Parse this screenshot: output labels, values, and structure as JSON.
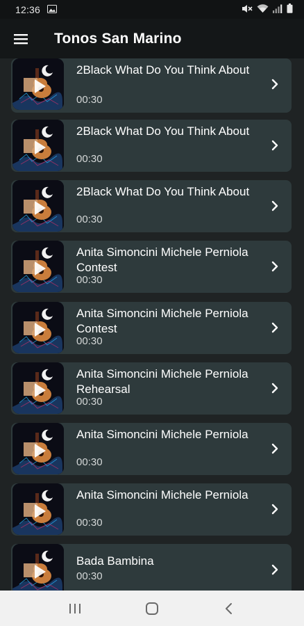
{
  "status": {
    "time": "12:36"
  },
  "app": {
    "title": "Tonos San Marino"
  },
  "icons": {
    "menu": "menu-icon",
    "chevron": "chevron-right-icon",
    "thumbnail": "guitar-play-icon"
  },
  "colors": {
    "background": "#1f2324",
    "card": "#2e3a3c",
    "app_bar": "#141718",
    "text": "#ffffff",
    "nav_bar": "#f1f1f1"
  },
  "songs": [
    {
      "title": "2Black What Do You Think About",
      "duration": "00:30"
    },
    {
      "title": "2Black What Do You Think About",
      "duration": "00:30"
    },
    {
      "title": "2Black What Do You Think About",
      "duration": "00:30"
    },
    {
      "title": "Anita Simoncini Michele Perniola   Contest",
      "duration": "00:30"
    },
    {
      "title": "Anita Simoncini Michele Perniola   Contest",
      "duration": "00:30"
    },
    {
      "title": "Anita Simoncini Michele Perniola   Rehearsal",
      "duration": "00:30"
    },
    {
      "title": "Anita Simoncini Michele Perniola",
      "duration": "00:30"
    },
    {
      "title": "Anita Simoncini Michele Perniola",
      "duration": "00:30"
    },
    {
      "title": "Bada Bambina",
      "duration": "00:30"
    }
  ]
}
